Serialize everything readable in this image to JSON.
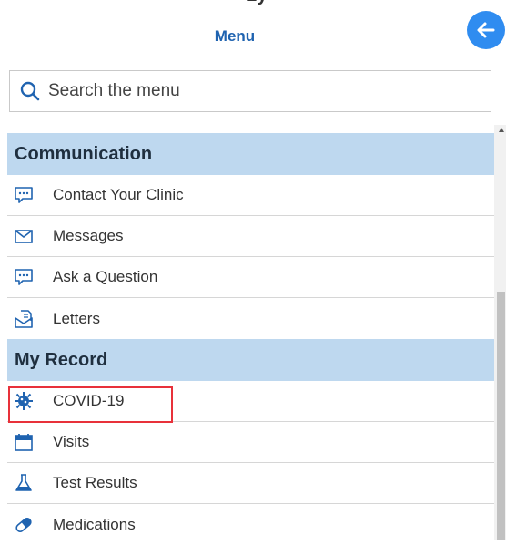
{
  "header": {
    "top_fragment": "Ly",
    "title": "Menu"
  },
  "search": {
    "placeholder": "Search the menu"
  },
  "sections": [
    {
      "title": "Communication",
      "items": [
        {
          "label": "Contact Your Clinic",
          "icon": "chat-icon"
        },
        {
          "label": "Messages",
          "icon": "envelope-icon"
        },
        {
          "label": "Ask a Question",
          "icon": "chat-icon"
        },
        {
          "label": "Letters",
          "icon": "letter-icon"
        }
      ]
    },
    {
      "title": "My Record",
      "items": [
        {
          "label": "COVID-19",
          "icon": "virus-icon"
        },
        {
          "label": "Visits",
          "icon": "calendar-icon"
        },
        {
          "label": "Test Results",
          "icon": "flask-icon"
        },
        {
          "label": "Medications",
          "icon": "pill-icon"
        }
      ]
    }
  ],
  "colors": {
    "accent": "#1f63b0",
    "back_button": "#2f8cf0",
    "section_header_bg": "#bed8ef",
    "highlight": "#e8313a"
  }
}
